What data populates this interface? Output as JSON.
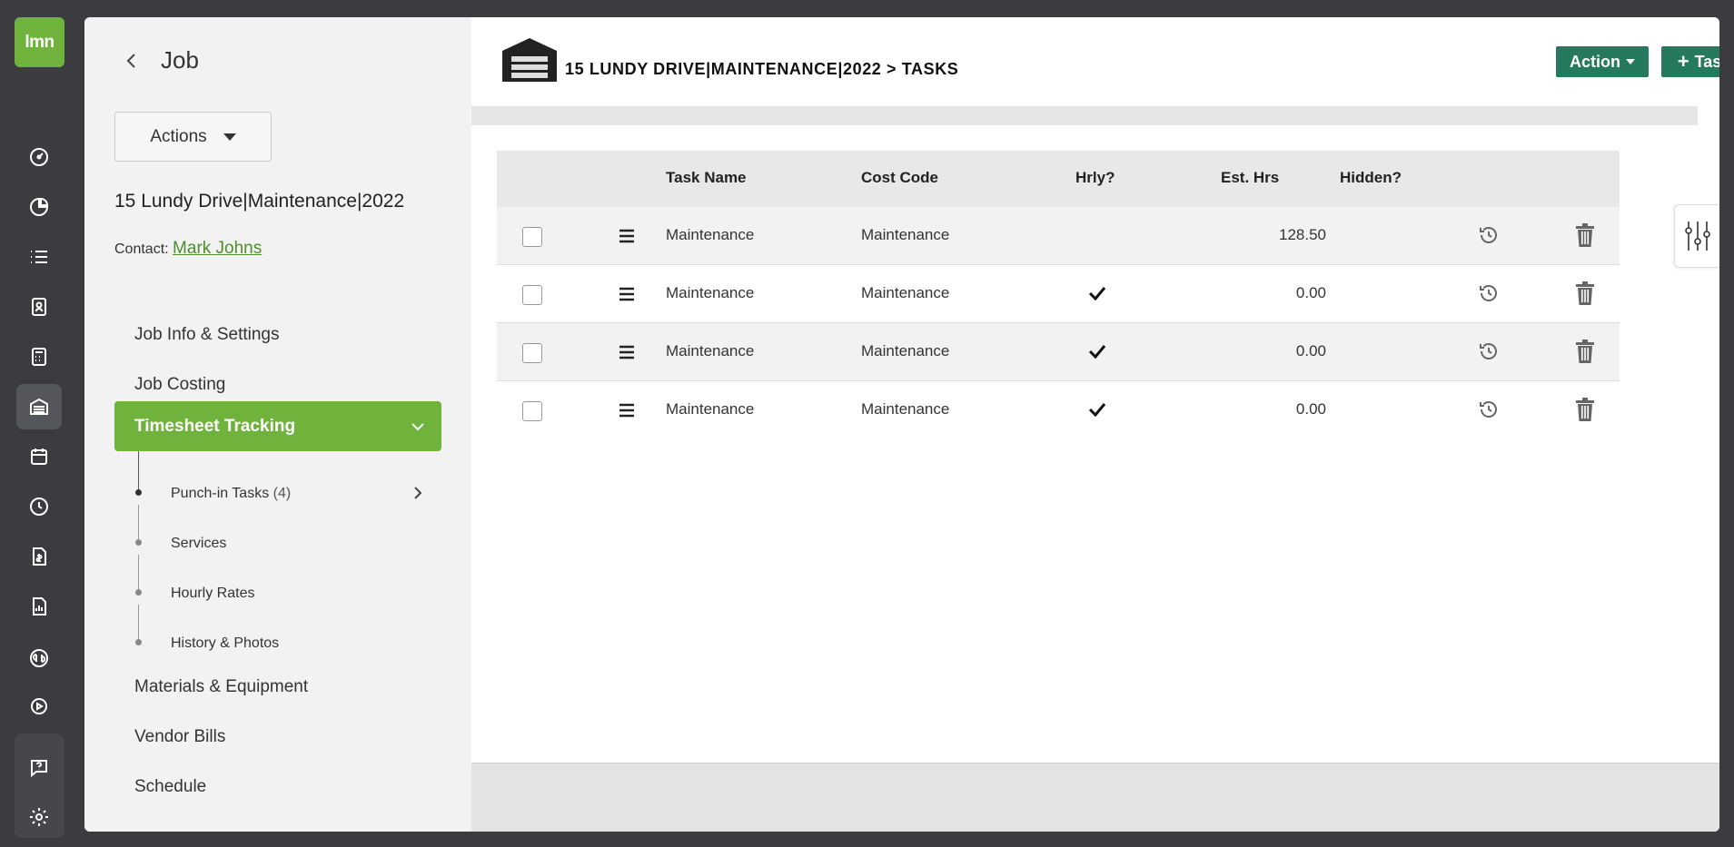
{
  "rail": {
    "logo_text": "lmn",
    "icons": [
      "dashboard-icon",
      "pie-chart-icon",
      "list-icon",
      "contacts-icon",
      "calculator-icon",
      "jobs-icon",
      "calendar-icon",
      "clock-icon",
      "invoice-icon",
      "reports-icon",
      "quickbooks-icon",
      "play-icon",
      "help-icon",
      "settings-gear-icon"
    ]
  },
  "side": {
    "back_title": "Job",
    "actions_label": "Actions",
    "job_name": "15 Lundy Drive|Maintenance|2022",
    "contact_label": "Contact:",
    "contact_name": "Mark Johns",
    "nav": {
      "job_info": "Job Info & Settings",
      "job_costing": "Job Costing",
      "timesheet_tracking": "Timesheet Tracking",
      "materials": "Materials & Equipment",
      "vendor_bills": "Vendor Bills",
      "schedule": "Schedule"
    },
    "sub": {
      "punch_in": "Punch-in Tasks",
      "punch_in_count": "(4)",
      "services": "Services",
      "hourly_rates": "Hourly Rates",
      "history": "History & Photos"
    }
  },
  "main": {
    "breadcrumb": "15 LUNDY DRIVE|MAINTENANCE|2022 > TASKS",
    "action_label": "Action",
    "task_label": "Task",
    "columns": {
      "task_name": "Task Name",
      "cost_code": "Cost Code",
      "hrly": "Hrly?",
      "est_hrs": "Est. Hrs",
      "hidden": "Hidden?"
    },
    "rows": [
      {
        "task": "Maintenance",
        "cost_code": "Maintenance",
        "hourly": false,
        "est_hrs": "128.50"
      },
      {
        "task": "Maintenance",
        "cost_code": "Maintenance",
        "hourly": true,
        "est_hrs": "0.00"
      },
      {
        "task": "Maintenance",
        "cost_code": "Maintenance",
        "hourly": true,
        "est_hrs": "0.00"
      },
      {
        "task": "Maintenance",
        "cost_code": "Maintenance",
        "hourly": true,
        "est_hrs": "0.00"
      }
    ]
  },
  "colors": {
    "brand_green": "#6fb33c",
    "button_green": "#257a5e",
    "rail_bg": "#3b3b40"
  }
}
